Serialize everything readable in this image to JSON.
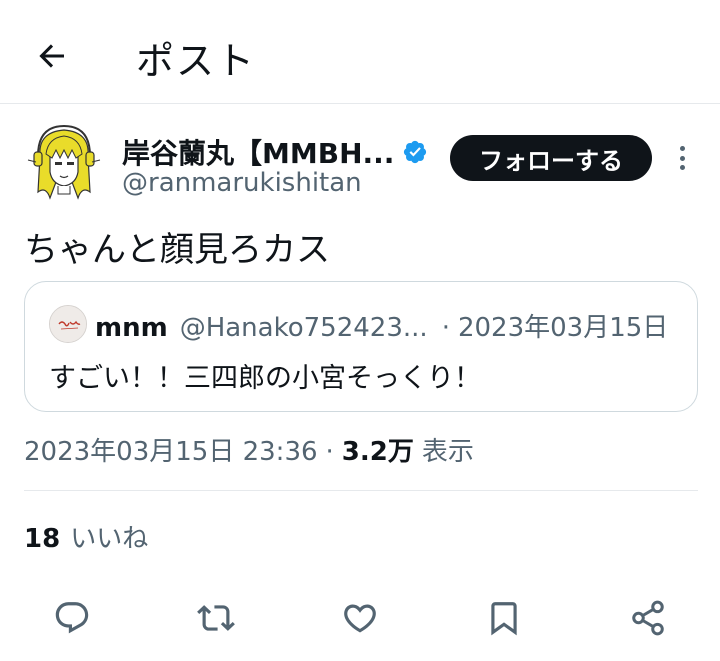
{
  "header": {
    "back_icon": "arrow-left-icon",
    "title": "ポスト"
  },
  "author": {
    "name": "岸谷蘭丸【MMBH...",
    "handle": "@ranmarukishitan",
    "verified_icon": "verified-badge-icon",
    "verified_color": "#1d9bf0",
    "follow_label": "フォローする",
    "more_icon": "more-vertical-icon"
  },
  "post": {
    "text": "ちゃんと顔見ろカス"
  },
  "quote": {
    "name": "mnm",
    "handle": "@Hanako752423...",
    "separator": "·",
    "date": "2023年03月15日",
    "text": "すごい！！三四郎の小宮そっくり！"
  },
  "meta": {
    "timestamp": "2023年03月15日 23:36",
    "separator": "·",
    "views": "3.2万",
    "views_label": "表示"
  },
  "stats": {
    "likes_count": "18",
    "likes_label": "いいね"
  },
  "actions": {
    "reply_icon": "reply-icon",
    "repost_icon": "repost-icon",
    "like_icon": "heart-icon",
    "bookmark_icon": "bookmark-icon",
    "share_icon": "share-icon"
  },
  "colors": {
    "text": "#0f1419",
    "secondary": "#536471",
    "border": "#cfd9de",
    "accent": "#1d9bf0"
  }
}
